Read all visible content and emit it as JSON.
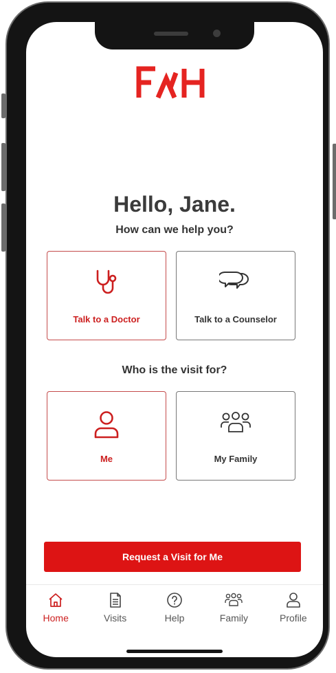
{
  "brand": {
    "logo_text": "FAH",
    "accent": "#dd1414"
  },
  "greeting": "Hello, Jane.",
  "prompt": "How can we help you?",
  "service_options": [
    {
      "label": "Talk to a Doctor",
      "icon": "stethoscope-icon",
      "selected": true
    },
    {
      "label": "Talk to a Counselor",
      "icon": "chat-bubbles-icon",
      "selected": false
    }
  ],
  "visit_prompt": "Who is the visit for?",
  "patient_options": [
    {
      "label": "Me",
      "icon": "person-icon",
      "selected": true
    },
    {
      "label": "My Family",
      "icon": "group-icon",
      "selected": false
    }
  ],
  "cta_label": "Request a Visit for Me",
  "tabs": [
    {
      "label": "Home",
      "icon": "home-icon",
      "active": true
    },
    {
      "label": "Visits",
      "icon": "document-icon",
      "active": false
    },
    {
      "label": "Help",
      "icon": "question-circle-icon",
      "active": false
    },
    {
      "label": "Family",
      "icon": "group-icon",
      "active": false
    },
    {
      "label": "Profile",
      "icon": "person-icon",
      "active": false
    }
  ]
}
